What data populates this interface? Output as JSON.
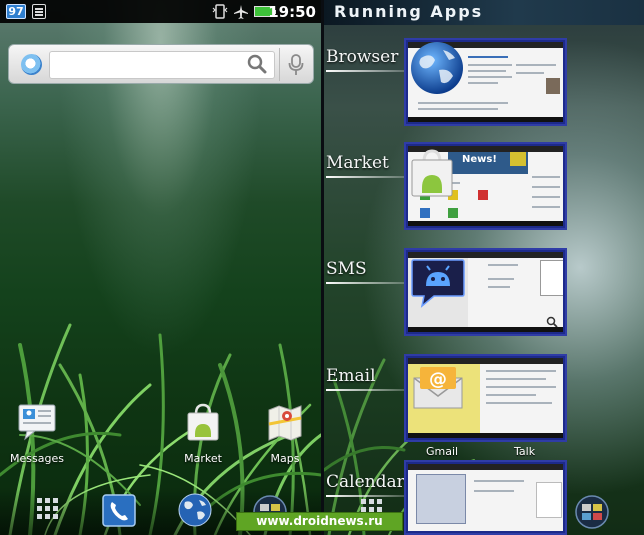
{
  "status_bar": {
    "notification_badge": "97",
    "clock": "19:50",
    "icons": [
      "notes-icon",
      "vibrate-icon",
      "airplane-mode-icon",
      "battery-icon"
    ]
  },
  "search": {
    "placeholder": ""
  },
  "home_apps": [
    {
      "label": "Messages",
      "icon": "messages-icon"
    },
    {
      "label": "Market",
      "icon": "market-icon"
    },
    {
      "label": "Maps",
      "icon": "maps-icon"
    }
  ],
  "dock": [
    "app-drawer-icon",
    "phone-icon",
    "browser-globe-icon",
    "running-apps-icon"
  ],
  "running_apps": {
    "title": "Running Apps",
    "apps": [
      {
        "label": "Browser"
      },
      {
        "label": "Market"
      },
      {
        "label": "SMS"
      },
      {
        "label": "Email"
      },
      {
        "label": "Calendar"
      }
    ],
    "email_accounts": [
      "Gmail",
      "Talk"
    ],
    "market_banner": "News!"
  },
  "watermark": "www.droidnews.ru",
  "colors": {
    "accent": "#2f3ca6",
    "battery": "#3ec23a",
    "watermark_bg": "#5fa524"
  }
}
